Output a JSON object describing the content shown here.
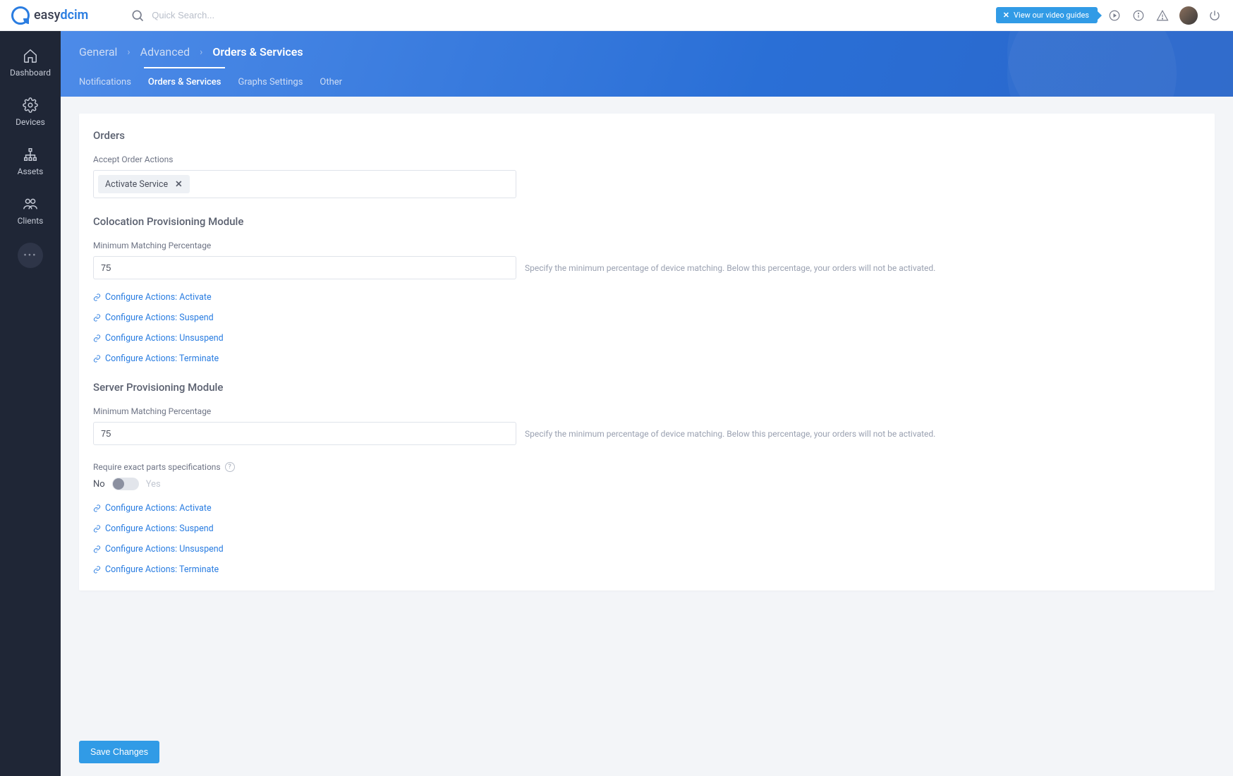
{
  "header": {
    "logo_left": "easy",
    "logo_right": "dcim",
    "search_placeholder": "Quick Search...",
    "video_badge": "View our video guides"
  },
  "sidebar": {
    "items": [
      {
        "label": "Dashboard"
      },
      {
        "label": "Devices"
      },
      {
        "label": "Assets"
      },
      {
        "label": "Clients"
      }
    ]
  },
  "breadcrumb": {
    "items": [
      "General",
      "Advanced",
      "Orders & Services"
    ]
  },
  "tabs": {
    "items": [
      "Notifications",
      "Orders & Services",
      "Graphs Settings",
      "Other"
    ],
    "active": 1
  },
  "sections": {
    "orders": {
      "title": "Orders",
      "accept_label": "Accept Order Actions",
      "chip": "Activate Service"
    },
    "colo": {
      "title": "Colocation Provisioning Module",
      "min_label": "Minimum Matching Percentage",
      "min_value": "75",
      "hint": "Specify the minimum percentage of device matching. Below this percentage, your orders will not be activated.",
      "links": [
        "Configure Actions: Activate",
        "Configure Actions: Suspend",
        "Configure Actions: Unsuspend",
        "Configure Actions: Terminate"
      ]
    },
    "server": {
      "title": "Server Provisioning Module",
      "min_label": "Minimum Matching Percentage",
      "min_value": "75",
      "hint": "Specify the minimum percentage of device matching. Below this percentage, your orders will not be activated.",
      "exact_label": "Require exact parts specifications",
      "toggle_no": "No",
      "toggle_yes": "Yes",
      "links": [
        "Configure Actions: Activate",
        "Configure Actions: Suspend",
        "Configure Actions: Unsuspend",
        "Configure Actions: Terminate"
      ]
    }
  },
  "footer": {
    "save": "Save Changes"
  }
}
